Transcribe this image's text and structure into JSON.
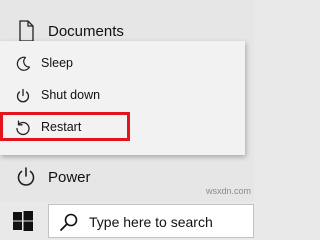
{
  "start_menu": {
    "documents_label": "Documents",
    "power_label": "Power"
  },
  "power_menu": {
    "items": [
      {
        "label": "Sleep",
        "icon": "moon-icon"
      },
      {
        "label": "Shut down",
        "icon": "power-icon"
      },
      {
        "label": "Restart",
        "icon": "restart-icon"
      }
    ],
    "highlighted_item": "Restart",
    "highlight_color": "#e3141c"
  },
  "taskbar": {
    "start_icon": "windows-logo-icon",
    "search_placeholder": "Type here to search"
  },
  "watermark": "wsxdn.com"
}
